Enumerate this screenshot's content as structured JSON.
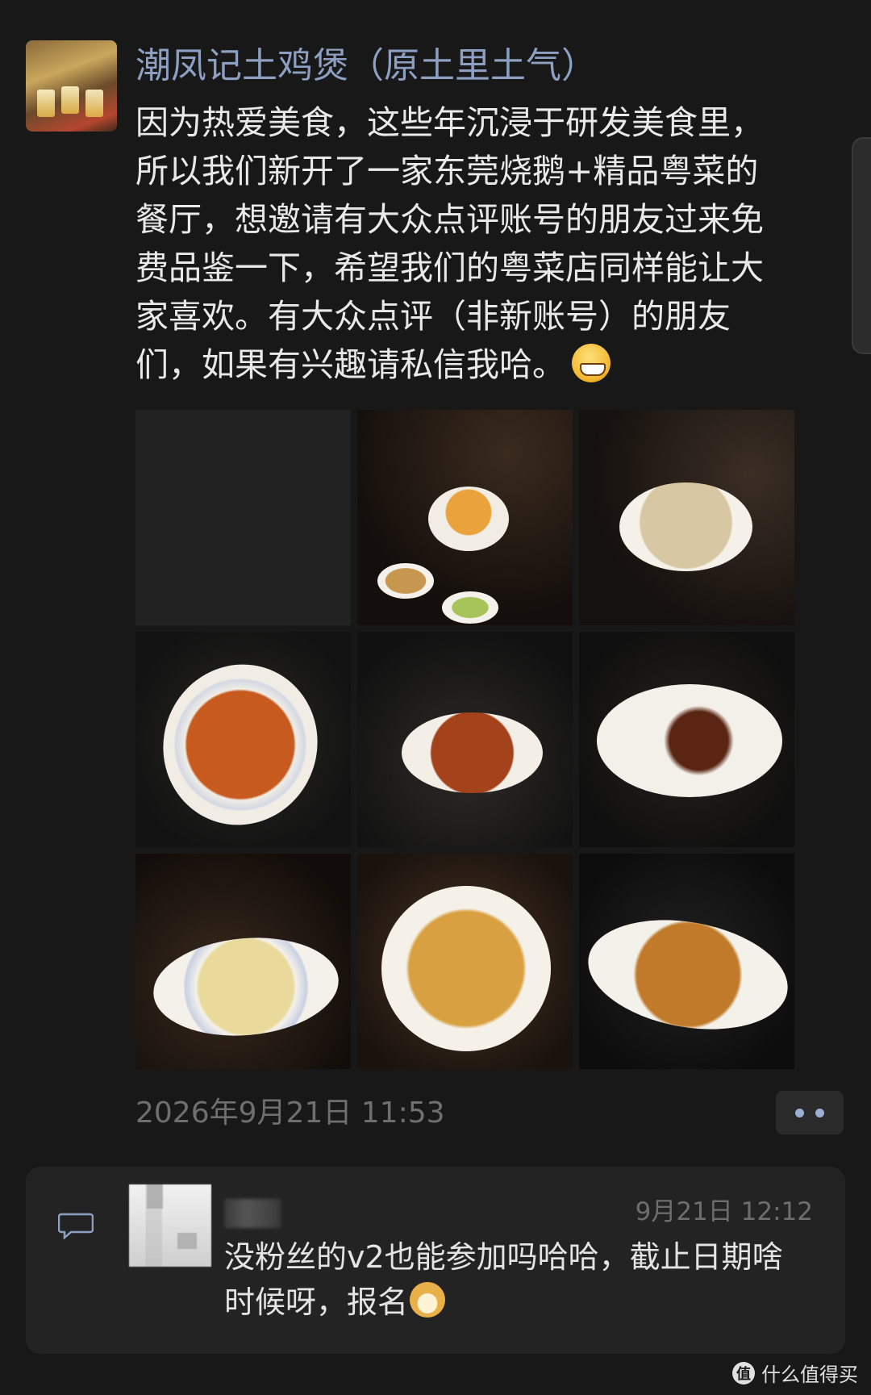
{
  "post": {
    "author": "潮凤记土鸡煲（原土里土气）",
    "text": "因为热爱美食，这些年沉浸于研发美食里，\n所以我们新开了一家东莞烧鹅+精品粤菜的\n餐厅，想邀请有大众点评账号的朋友过来免\n费品鉴一下，希望我们的粤菜店同样能让大\n家喜欢。有大众点评（非新账号）的朋友\n们，如果有兴趣请私信我哈。",
    "text_emoji": "grin-emoji",
    "timestamp": "2026年9月21日 11:53"
  },
  "photos": [
    {
      "name": "photo-blank"
    },
    {
      "name": "photo-soup-bowl"
    },
    {
      "name": "photo-tofu-bowl"
    },
    {
      "name": "photo-squid-plate"
    },
    {
      "name": "photo-roast-goose"
    },
    {
      "name": "photo-char-siu"
    },
    {
      "name": "photo-white-chicken"
    },
    {
      "name": "photo-prawns"
    },
    {
      "name": "photo-fish-maw"
    }
  ],
  "comment": {
    "time": "9月21日 12:12",
    "text": "没粉丝的v2也能参加吗哈哈，截止日期啥\n时候呀，报名",
    "emoji": "doge-emoji"
  },
  "watermark": {
    "logo": "值",
    "text": "什么值得买"
  },
  "colors": {
    "background": "#181818",
    "author_link": "#8da0c2",
    "secondary_text": "#6f6f6f",
    "card": "#232323"
  }
}
